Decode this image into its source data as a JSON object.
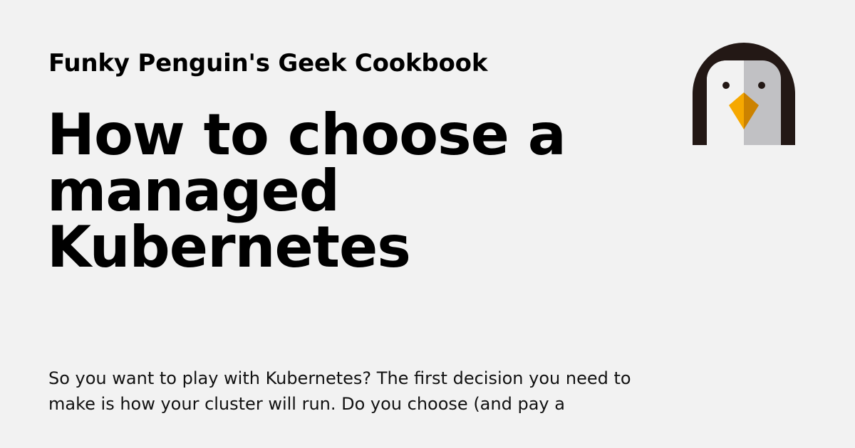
{
  "header": {
    "site_name": "Funky Penguin's Geek Cookbook",
    "logo_icon": "penguin-icon"
  },
  "article": {
    "title": "How to choose a managed Kubernetes",
    "description": "So you want to play with Kubernetes? The first decision you need to make is how your cluster will run. Do you choose (and pay a"
  },
  "colors": {
    "background": "#f2f2f2",
    "text": "#000000",
    "penguin_dark": "#231815",
    "penguin_face": "#c1c1c4",
    "beak_light": "#f6a800",
    "beak_dark": "#cc8200"
  }
}
